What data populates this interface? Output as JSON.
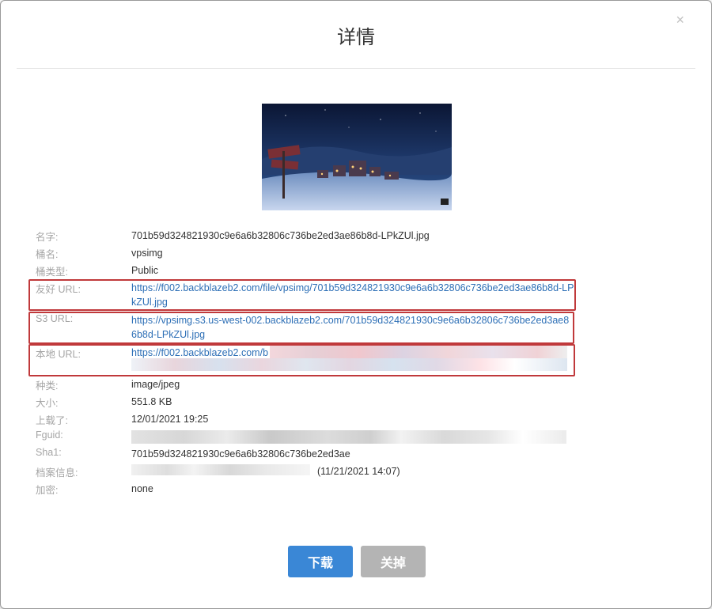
{
  "dialog": {
    "title": "详情",
    "close_symbol": "×"
  },
  "preview": {
    "image_icon": "winter-village-image",
    "description": ""
  },
  "details": [
    {
      "key": "name",
      "label": "名字:",
      "value": "701b59d324821930c9e6a6b32806c736be2ed3ae86b8d-LPkZUl.jpg"
    },
    {
      "key": "bucket",
      "label": "桶名:",
      "value": "vpsimg"
    },
    {
      "key": "bucket_type",
      "label": "桶类型:",
      "value": "Public"
    },
    {
      "key": "friendly_url",
      "label": "友好 URL:",
      "value": "https://f002.backblazeb2.com/file/vpsimg/701b59d324821930c9e6a6b32806c736be2ed3ae86b8d-LPkZUl.jpg"
    },
    {
      "key": "s3_url",
      "label": "S3 URL:",
      "value": "https://vpsimg.s3.us-west-002.backblazeb2.com/701b59d324821930c9e6a6b32806c736be2ed3ae86b8d-LPkZUl.jpg"
    },
    {
      "key": "local_url",
      "label": "本地 URL:",
      "value": "https://f002.backblazeb2.com/b"
    },
    {
      "key": "type",
      "label": "种类:",
      "value": "image/jpeg"
    },
    {
      "key": "size",
      "label": "大小:",
      "value": "551.8 KB"
    },
    {
      "key": "uploaded",
      "label": "上载了:",
      "value": "12/01/2021 19:25"
    },
    {
      "key": "fguid",
      "label": "Fguid:",
      "value": ""
    },
    {
      "key": "sha1",
      "label": "Sha1:",
      "value": "701b59d324821930c9e6a6b32806c736be2ed3ae"
    },
    {
      "key": "file_info",
      "label": "档案信息:",
      "value": "(11/21/2021 14:07)"
    },
    {
      "key": "encryption",
      "label": "加密:",
      "value": "none"
    }
  ],
  "buttons": {
    "download": "下载",
    "close": "关掉"
  },
  "colors": {
    "primary": "#3a87d6",
    "secondary": "#b4b4b4",
    "link": "#2d6fb6",
    "highlight": "#c0393b"
  }
}
